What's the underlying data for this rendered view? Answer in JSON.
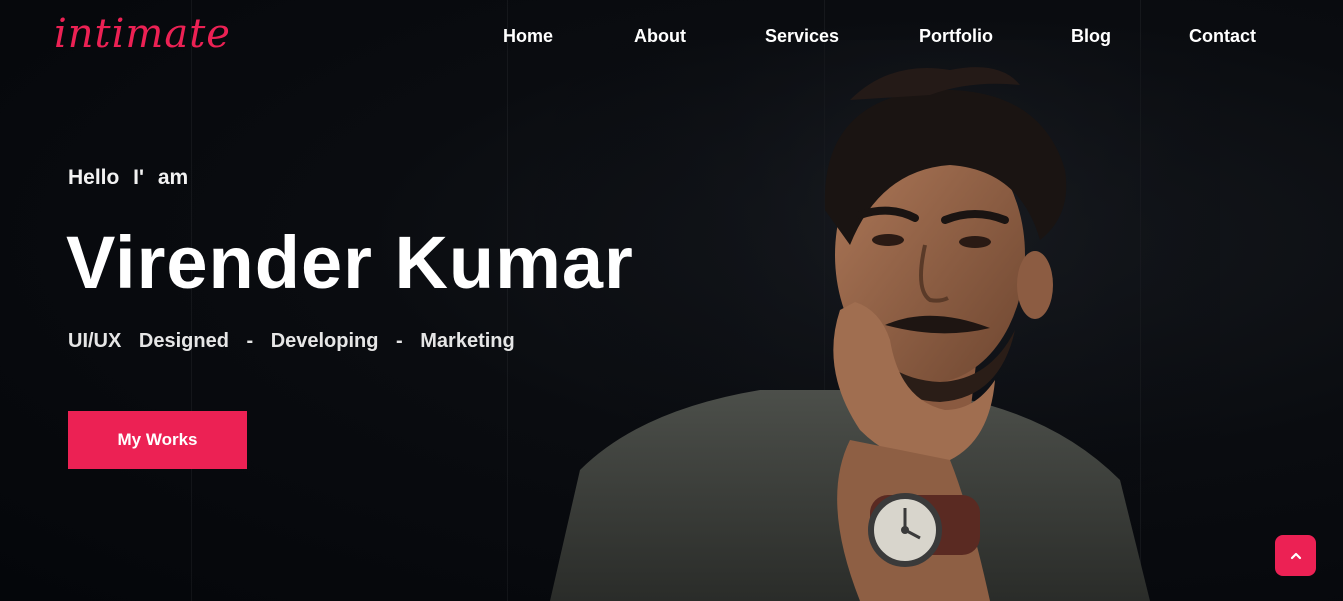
{
  "header": {
    "logo_text": "intimate",
    "nav": [
      {
        "label": "Home"
      },
      {
        "label": "About"
      },
      {
        "label": "Services"
      },
      {
        "label": "Portfolio"
      },
      {
        "label": "Blog"
      },
      {
        "label": "Contact"
      }
    ]
  },
  "hero": {
    "greeting": "Hello I' am",
    "name": "Virender Kumar",
    "tagline": "UI/UX Designed - Developing - Marketing",
    "cta_label": "My Works"
  },
  "scroll_top": {
    "icon": "chevron-up-icon"
  },
  "colors": {
    "accent": "#ec2154",
    "background": "#05070c",
    "text": "#ffffff"
  }
}
